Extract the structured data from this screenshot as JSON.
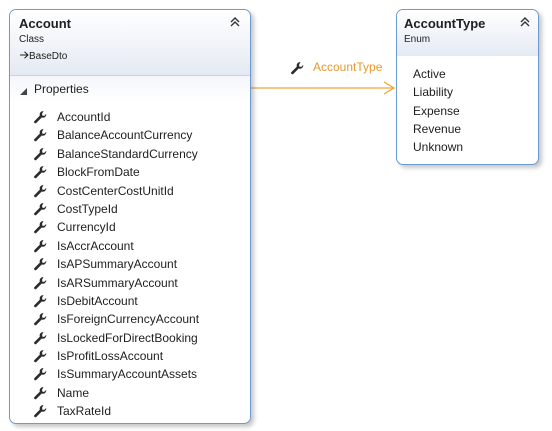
{
  "colors": {
    "border": "#6b9bd2",
    "association": "#f5a33c",
    "association_label": "#e69a2e",
    "icon": "#2b2b2b",
    "header_gradient_bottom": "#e4eaf3"
  },
  "account": {
    "title": "Account",
    "stereotype": "Class",
    "base_type": "BaseDto",
    "inherit_icon": "inheritance-arrow-icon",
    "collapse_icon": "double-chevron-up-icon",
    "section": {
      "label": "Properties",
      "expand_icon": "expanded-triangle-icon"
    },
    "properties": [
      {
        "name": "AccountId",
        "icon": "wrench-icon"
      },
      {
        "name": "BalanceAccountCurrency",
        "icon": "wrench-icon"
      },
      {
        "name": "BalanceStandardCurrency",
        "icon": "wrench-icon"
      },
      {
        "name": "BlockFromDate",
        "icon": "wrench-icon"
      },
      {
        "name": "CostCenterCostUnitId",
        "icon": "wrench-icon"
      },
      {
        "name": "CostTypeId",
        "icon": "wrench-icon"
      },
      {
        "name": "CurrencyId",
        "icon": "wrench-icon"
      },
      {
        "name": "IsAccrAccount",
        "icon": "wrench-icon"
      },
      {
        "name": "IsAPSummaryAccount",
        "icon": "wrench-icon"
      },
      {
        "name": "IsARSummaryAccount",
        "icon": "wrench-icon"
      },
      {
        "name": "IsDebitAccount",
        "icon": "wrench-icon"
      },
      {
        "name": "IsForeignCurrencyAccount",
        "icon": "wrench-icon"
      },
      {
        "name": "IsLockedForDirectBooking",
        "icon": "wrench-icon"
      },
      {
        "name": "IsProfitLossAccount",
        "icon": "wrench-icon"
      },
      {
        "name": "IsSummaryAccountAssets",
        "icon": "wrench-icon"
      },
      {
        "name": "Name",
        "icon": "wrench-icon"
      },
      {
        "name": "TaxRateId",
        "icon": "wrench-icon"
      }
    ]
  },
  "account_type": {
    "title": "AccountType",
    "stereotype": "Enum",
    "collapse_icon": "double-chevron-up-icon",
    "values": [
      "Active",
      "Liability",
      "Expense",
      "Revenue",
      "Unknown"
    ]
  },
  "association": {
    "label": "AccountType",
    "icon": "wrench-icon"
  }
}
